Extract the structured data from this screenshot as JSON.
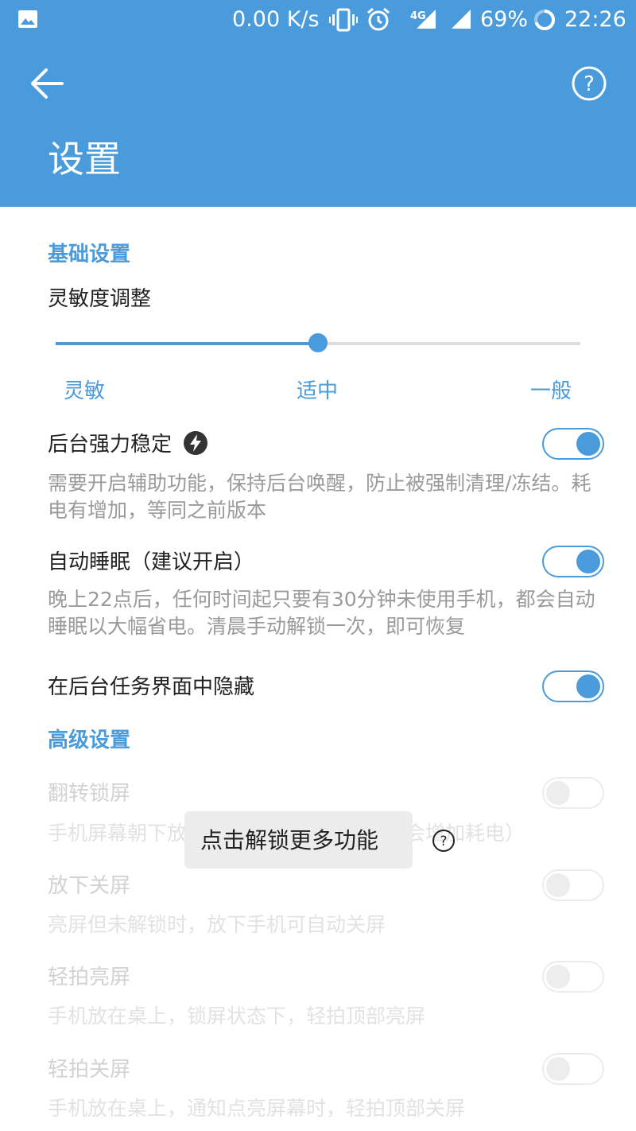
{
  "status_bar": {
    "speed": "0.00 K/s",
    "network": "4G",
    "battery": "69%",
    "time": "22:26",
    "icons": [
      "image-icon",
      "vibrate-icon",
      "alarm-icon",
      "signal-icon",
      "battery-ring-icon"
    ]
  },
  "app_bar": {
    "title": "设置",
    "back_icon": "arrow-left-icon",
    "help_icon": "question-circle-icon"
  },
  "basic": {
    "header": "基础设置",
    "sensitivity": {
      "label": "灵敏度调整",
      "value_fraction": 0.5,
      "ticks": [
        "灵敏",
        "适中",
        "一般"
      ]
    },
    "items": [
      {
        "label": "后台强力稳定",
        "desc": "需要开启辅助功能，保持后台唤醒，防止被强制清理/冻结。耗电有增加，等同之前版本",
        "on": true
      },
      {
        "label": "自动睡眠（建议开启）",
        "desc": "晚上22点后，任何时间起只要有30分钟未使用手机，都会自动睡眠以大幅省电。清晨手动解锁一次，即可恢复",
        "on": true
      },
      {
        "label": "在后台任务界面中隐藏",
        "desc": "",
        "on": true
      }
    ]
  },
  "advanced": {
    "header": "高级设置",
    "items": [
      {
        "label": "翻转锁屏",
        "desc": "手机屏幕朝下放在桌上，自动锁屏（可能会增加耗电）",
        "on": false
      },
      {
        "label": "放下关屏",
        "desc": "亮屏但未解锁时，放下手机可自动关屏",
        "on": false
      },
      {
        "label": "轻拍亮屏",
        "desc": "手机放在桌上，锁屏状态下，轻拍顶部亮屏",
        "on": false
      },
      {
        "label": "轻拍关屏",
        "desc": "手机放在桌上，通知点亮屏幕时，轻拍顶部关屏",
        "on": false
      }
    ]
  },
  "unlock_toast": {
    "label": "点击解锁更多功能"
  },
  "colors": {
    "primary": "#4a9bdc",
    "text": "#222222",
    "secondary_text": "#9a9a9a",
    "disabled_text": "#d2d2d2"
  }
}
